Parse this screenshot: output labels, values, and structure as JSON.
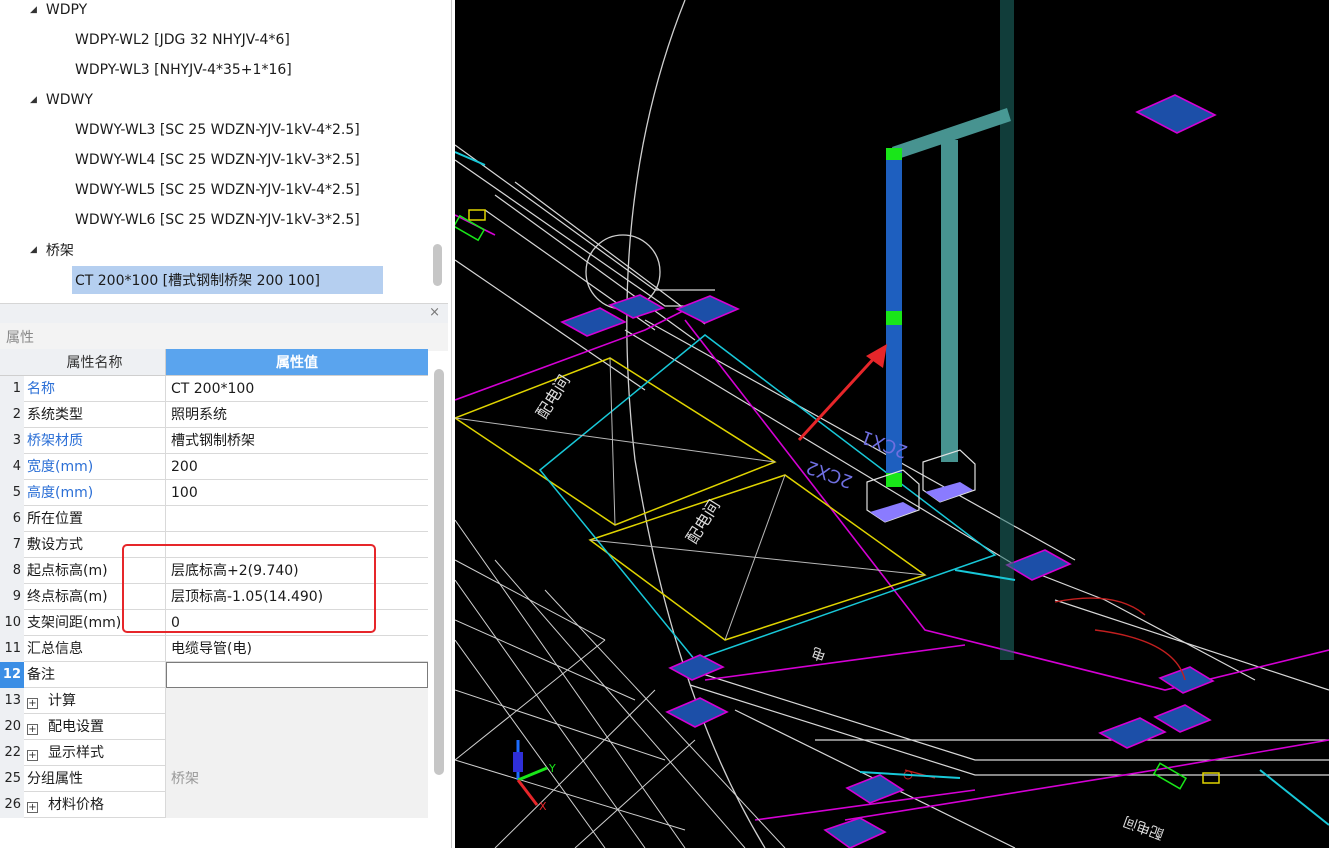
{
  "tree": {
    "groups": [
      {
        "label": "WDPY",
        "items": [
          "WDPY-WL2 [JDG 32 NHYJV-4*6]",
          "WDPY-WL3 [NHYJV-4*35+1*16]"
        ]
      },
      {
        "label": "WDWY",
        "items": [
          "WDWY-WL3 [SC 25 WDZN-YJV-1kV-4*2.5]",
          "WDWY-WL4 [SC 25 WDZN-YJV-1kV-3*2.5]",
          "WDWY-WL5 [SC 25 WDZN-YJV-1kV-4*2.5]",
          "WDWY-WL6 [SC 25 WDZN-YJV-1kV-3*2.5]"
        ]
      },
      {
        "label": "桥架",
        "items": [
          "CT 200*100 [槽式钢制桥架 200 100]"
        ]
      }
    ],
    "selected": "CT 200*100 [槽式钢制桥架 200 100]"
  },
  "panel": {
    "close": "×",
    "title": "属性"
  },
  "grid": {
    "header": {
      "name": "属性名称",
      "value": "属性值"
    },
    "rows": [
      {
        "idx": "1",
        "name": "名称",
        "value": "CT 200*100"
      },
      {
        "idx": "2",
        "name": "系统类型",
        "value": "照明系统"
      },
      {
        "idx": "3",
        "name": "桥架材质",
        "value": "槽式钢制桥架"
      },
      {
        "idx": "4",
        "name": "宽度(mm)",
        "value": "200"
      },
      {
        "idx": "5",
        "name": "高度(mm)",
        "value": "100"
      },
      {
        "idx": "6",
        "name": "所在位置",
        "value": ""
      },
      {
        "idx": "7",
        "name": "敷设方式",
        "value": ""
      },
      {
        "idx": "8",
        "name": "起点标高(m)",
        "value": "层底标高+2(9.740)"
      },
      {
        "idx": "9",
        "name": "终点标高(m)",
        "value": "层顶标高-1.05(14.490)"
      },
      {
        "idx": "10",
        "name": "支架间距(mm)",
        "value": "0"
      },
      {
        "idx": "11",
        "name": "汇总信息",
        "value": "电缆导管(电)"
      },
      {
        "idx": "12",
        "name": "备注",
        "value": ""
      },
      {
        "idx": "13",
        "name": "计算",
        "value": ""
      },
      {
        "idx": "20",
        "name": "配电设置",
        "value": ""
      },
      {
        "idx": "22",
        "name": "显示样式",
        "value": ""
      },
      {
        "idx": "25",
        "name": "分组属性",
        "value": "桥架"
      },
      {
        "idx": "26",
        "name": "材料价格",
        "value": ""
      }
    ]
  },
  "cad": {
    "labels": {
      "room_a": "配电间",
      "room_b": "配电间",
      "tag1": "2CX2",
      "tag2": "2CX1",
      "door": "电",
      "room_c": "配电间"
    },
    "axis": {
      "x": "X",
      "y": "Y"
    },
    "colors": {
      "background": "#000000",
      "tray_selected": "#1e5fbf",
      "tray_other": "#4fa3a0",
      "node_marker": "#19e619",
      "annotation": "#e6262a"
    }
  }
}
